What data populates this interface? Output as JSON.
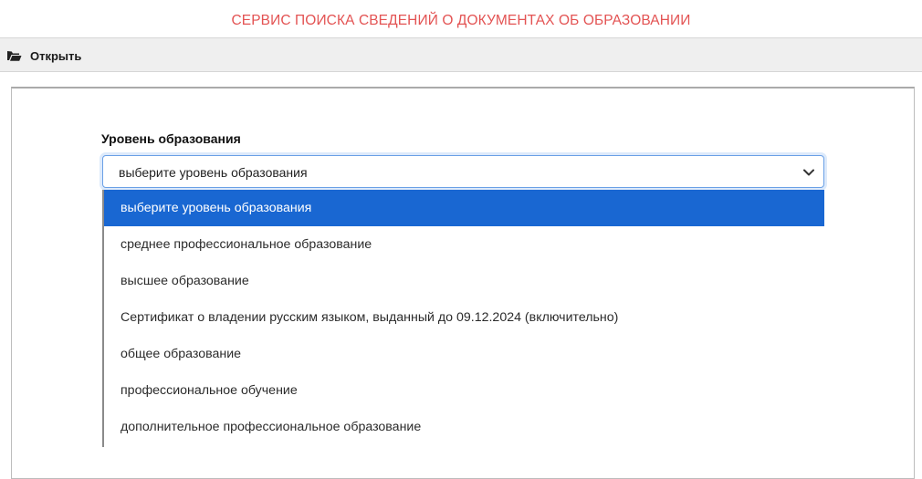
{
  "header": {
    "title": "СЕРВИС ПОИСКА СВЕДЕНИЙ О ДОКУМЕНТАХ ОБ ОБРАЗОВАНИИ",
    "title_color": "#e35353"
  },
  "toolbar": {
    "open_label": "Открыть",
    "open_icon": "folder-open-icon"
  },
  "form": {
    "education_level_label": "Уровень образования",
    "education_level_value": "выберите уровень образования",
    "chevron_icon": "chevron-down-icon",
    "options": [
      "выберите уровень образования",
      "среднее профессиональное образование",
      "высшее образование",
      "Сертификат о владении русским языком, выданный до 09.12.2024 (включительно)",
      "общее образование",
      "профессиональное обучение",
      "дополнительное профессиональное образование"
    ],
    "highlighted_option_index": 0,
    "highlight_color": "#1967d2"
  }
}
